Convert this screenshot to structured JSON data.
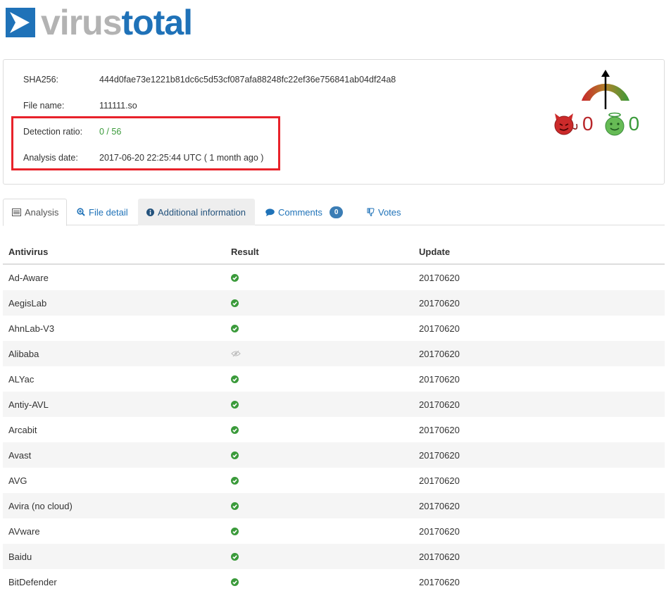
{
  "logo": {
    "word1": "virus",
    "word2": "total"
  },
  "info": {
    "sha256_label": "SHA256:",
    "sha256_value": "444d0fae73e1221b81dc6c5d53cf087afa88248fc22ef36e756841ab04df24a8",
    "filename_label": "File name:",
    "filename_value": "111111.so",
    "ratio_label": "Detection ratio:",
    "ratio_value": "0 / 56",
    "date_label": "Analysis date:",
    "date_value": "2017-06-20 22:25:44 UTC ( 1 month ago )"
  },
  "votes": {
    "malicious": "0",
    "harmless": "0"
  },
  "colors": {
    "brand": "#1f72b8",
    "ok": "#3a9a3a",
    "bad": "#b8262a",
    "highlight": "#e8222a"
  },
  "tabs": [
    {
      "label": "Analysis",
      "icon": "list-icon"
    },
    {
      "label": "File detail",
      "icon": "search-plus-icon"
    },
    {
      "label": "Additional information",
      "icon": "info-circle-icon"
    },
    {
      "label": "Comments",
      "icon": "comment-icon",
      "badge": "0"
    },
    {
      "label": "Votes",
      "icon": "thumbs-down-icon"
    }
  ],
  "table": {
    "headers": [
      "Antivirus",
      "Result",
      "Update"
    ],
    "rows": [
      {
        "antivirus": "Ad-Aware",
        "result": "clean",
        "update": "20170620"
      },
      {
        "antivirus": "AegisLab",
        "result": "clean",
        "update": "20170620"
      },
      {
        "antivirus": "AhnLab-V3",
        "result": "clean",
        "update": "20170620"
      },
      {
        "antivirus": "Alibaba",
        "result": "unsupported",
        "update": "20170620"
      },
      {
        "antivirus": "ALYac",
        "result": "clean",
        "update": "20170620"
      },
      {
        "antivirus": "Antiy-AVL",
        "result": "clean",
        "update": "20170620"
      },
      {
        "antivirus": "Arcabit",
        "result": "clean",
        "update": "20170620"
      },
      {
        "antivirus": "Avast",
        "result": "clean",
        "update": "20170620"
      },
      {
        "antivirus": "AVG",
        "result": "clean",
        "update": "20170620"
      },
      {
        "antivirus": "Avira (no cloud)",
        "result": "clean",
        "update": "20170620"
      },
      {
        "antivirus": "AVware",
        "result": "clean",
        "update": "20170620"
      },
      {
        "antivirus": "Baidu",
        "result": "clean",
        "update": "20170620"
      },
      {
        "antivirus": "BitDefender",
        "result": "clean",
        "update": "20170620"
      }
    ]
  }
}
